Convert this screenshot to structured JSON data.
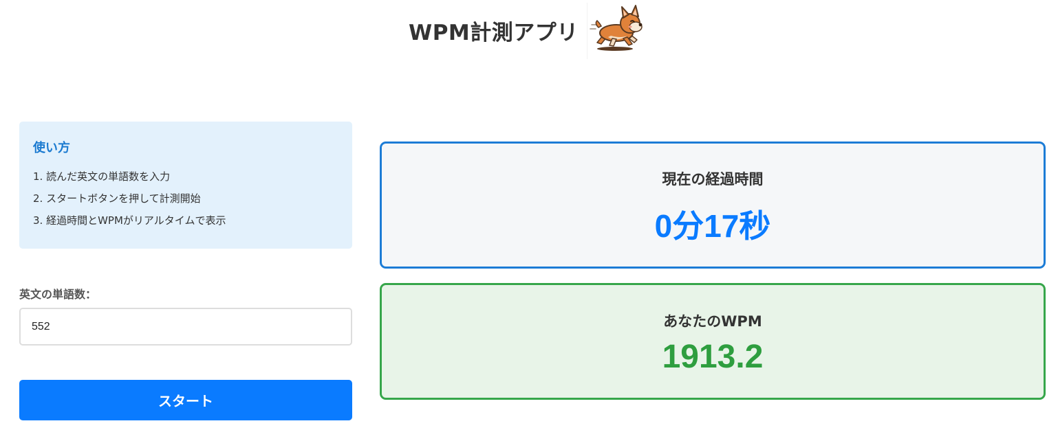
{
  "header": {
    "title": "WPM計測アプリ",
    "mascot_icon": "running-corgi-icon"
  },
  "instructions": {
    "title": "使い方",
    "steps": [
      "1. 読んだ英文の単語数を入力",
      "2. スタートボタンを押して計測開始",
      "3. 経過時間とWPMがリアルタイムで表示"
    ]
  },
  "form": {
    "word_count_label": "英文の単語数：",
    "word_count_value": "552",
    "start_label": "スタート"
  },
  "elapsed": {
    "label": "現在の経過時間",
    "value": "0分17秒"
  },
  "wpm": {
    "label": "あなたのWPM",
    "value": "1913.2"
  },
  "colors": {
    "accent_blue": "#0a7bff",
    "time_border": "#1c7cd6",
    "wpm_border": "#36a64a",
    "wpm_text": "#2e9e3f",
    "instructions_bg": "#e3f1fc"
  }
}
